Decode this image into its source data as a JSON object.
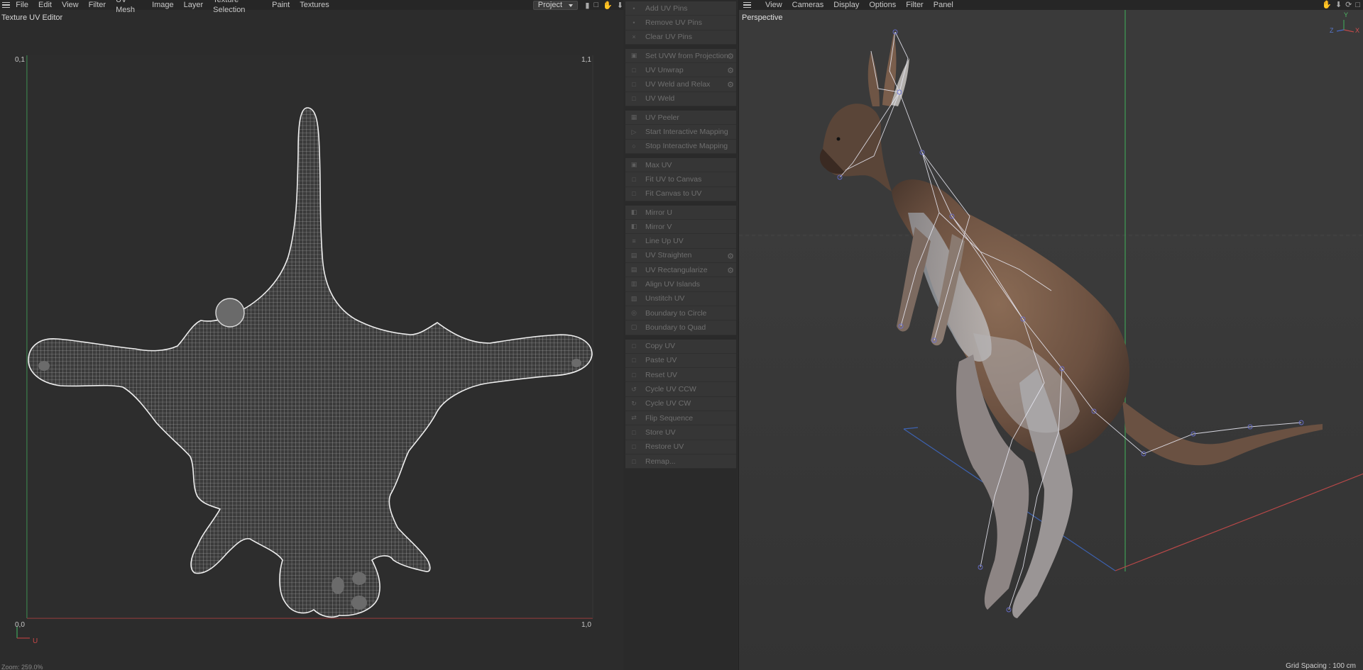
{
  "uv_editor": {
    "menu": [
      "File",
      "Edit",
      "View",
      "Filter",
      "UV Mesh",
      "Image",
      "Layer",
      "Texture Selection",
      "Paint",
      "Textures"
    ],
    "project_select": "Project",
    "title": "Texture UV Editor",
    "corners": {
      "top_left": "0,1",
      "top_right": "1,1",
      "bottom_left": "0,0",
      "bottom_right": "1,0"
    },
    "axis_u": "U",
    "zoom": "Zoom: 259.0%"
  },
  "commands": {
    "groups": [
      [
        {
          "label": "Add UV Pins",
          "icon": "pin-icon"
        },
        {
          "label": "Remove UV Pins",
          "icon": "pin-icon"
        },
        {
          "label": "Clear UV Pins",
          "icon": "close-icon"
        }
      ],
      [
        {
          "label": "Set UVW from Projection",
          "icon": "projection-icon",
          "gear": true
        },
        {
          "label": "UV Unwrap",
          "icon": "unwrap-icon",
          "gear": true
        },
        {
          "label": "UV Weld and Relax",
          "icon": "relax-icon",
          "gear": true
        },
        {
          "label": "UV Weld",
          "icon": "weld-icon"
        }
      ],
      [
        {
          "label": "UV Peeler",
          "icon": "peeler-icon"
        },
        {
          "label": "Start Interactive Mapping",
          "icon": "play-icon"
        },
        {
          "label": "Stop Interactive Mapping",
          "icon": "stop-icon"
        }
      ],
      [
        {
          "label": "Max UV",
          "icon": "max-icon"
        },
        {
          "label": "Fit UV to Canvas",
          "icon": "fit-icon"
        },
        {
          "label": "Fit Canvas to UV",
          "icon": "fit-icon"
        }
      ],
      [
        {
          "label": "Mirror U",
          "icon": "mirror-icon"
        },
        {
          "label": "Mirror V",
          "icon": "mirror-icon"
        },
        {
          "label": "Line Up UV",
          "icon": "lineup-icon"
        },
        {
          "label": "UV Straighten",
          "icon": "straighten-icon",
          "gear": true
        },
        {
          "label": "UV Rectangularize",
          "icon": "rect-icon",
          "gear": true
        },
        {
          "label": "Align UV Islands",
          "icon": "align-icon"
        },
        {
          "label": "Unstitch UV",
          "icon": "unstitch-icon"
        },
        {
          "label": "Boundary to Circle",
          "icon": "circle-icon"
        },
        {
          "label": "Boundary to Quad",
          "icon": "quad-icon"
        }
      ],
      [
        {
          "label": "Copy UV",
          "icon": "copy-icon"
        },
        {
          "label": "Paste UV",
          "icon": "paste-icon"
        },
        {
          "label": "Reset UV",
          "icon": "reset-icon"
        },
        {
          "label": "Cycle UV CCW",
          "icon": "ccw-icon"
        },
        {
          "label": "Cycle UV CW",
          "icon": "cw-icon"
        },
        {
          "label": "Flip Sequence",
          "icon": "flip-icon"
        },
        {
          "label": "Store UV",
          "icon": "store-icon"
        },
        {
          "label": "Restore UV",
          "icon": "restore-icon"
        },
        {
          "label": "Remap...",
          "icon": "remap-icon"
        }
      ]
    ]
  },
  "viewport": {
    "menu": [
      "View",
      "Cameras",
      "Display",
      "Options",
      "Filter",
      "Panel"
    ],
    "title": "Perspective",
    "axis": {
      "x": "X",
      "y": "Y",
      "z": "Z"
    },
    "grid_spacing": "Grid Spacing : 100 cm"
  },
  "colors": {
    "mesh_line": "#d8d8d8",
    "u_axis": "#b04040",
    "v_axis": "#3fa35a",
    "grid_x": "#b84848",
    "grid_z": "#3d62b0",
    "grid_y": "#3f9f55",
    "kangaroo_fur": "#6b5546",
    "rig_bone": "#e8e8f0"
  }
}
